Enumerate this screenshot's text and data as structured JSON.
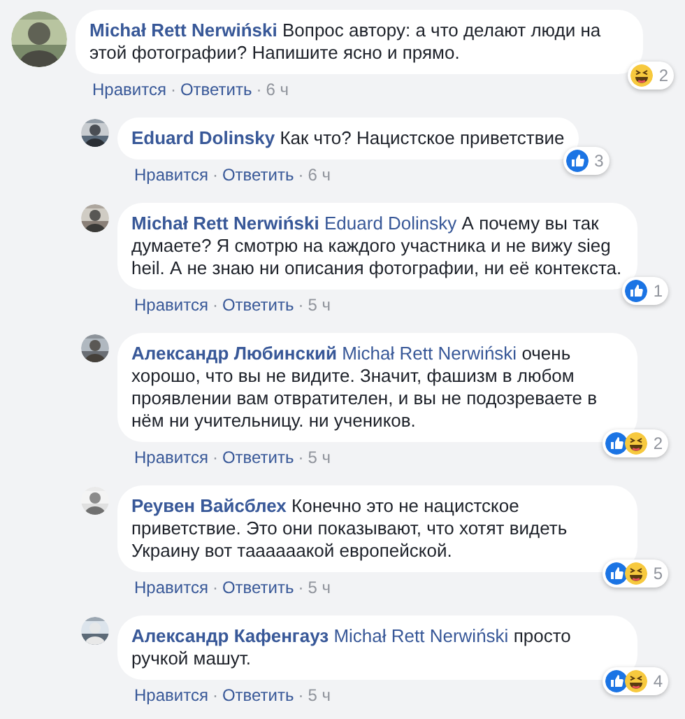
{
  "comments": [
    {
      "author": "Michał Rett Nerwiński",
      "text": "Вопрос автору: а что делают люди на этой фотографии? Напишите ясно и прямо.",
      "reply": false,
      "liked": false,
      "laughed": true,
      "count": "2",
      "actions": [
        "Нравится",
        "Ответить"
      ],
      "separator": "·",
      "time": "6 ч"
    },
    {
      "author": "Eduard Dolinsky",
      "text": "Как что? Нацистское приветствие",
      "reply": true,
      "liked": true,
      "laughed": false,
      "count": "3",
      "actions": [
        "Нравится",
        "Ответить"
      ],
      "separator": "·",
      "time": "6 ч"
    },
    {
      "author": "Michał Rett Nerwiński",
      "mention": "Eduard Dolinsky",
      "text": "А почему вы так думаете? Я смотрю на каждого участника и не вижу sieg heil. А не знаю ни описания фотографии, ни её контекста.",
      "reply": true,
      "liked": true,
      "laughed": false,
      "count": "1",
      "actions": [
        "Нравится",
        "Ответить"
      ],
      "separator": "·",
      "time": "5 ч"
    },
    {
      "author": "Александр Любинский",
      "mention": "Michał Rett Nerwiński",
      "text": "очень хорошо, что вы не видите. Значит, фашизм в любом проявлении вам отвратителен, и вы не подозреваете в нём ни учительницу. ни учеников.",
      "reply": true,
      "liked": true,
      "laughed": true,
      "count": "2",
      "actions": [
        "Нравится",
        "Ответить"
      ],
      "separator": "·",
      "time": "5 ч"
    },
    {
      "author": "Реувен Вайсблех",
      "text": "Конечно это не нацистское приветствие. Это они показывают, что хотят видеть Украину вот таааааакой европейской.",
      "reply": true,
      "liked": true,
      "laughed": true,
      "count": "5",
      "actions": [
        "Нравится",
        "Ответить"
      ],
      "separator": "·",
      "time": "5 ч"
    },
    {
      "author": "Александр Кафенгауз",
      "mention": "Michał Rett Nerwiński",
      "text": "просто ручкой машут.",
      "reply": true,
      "liked": true,
      "laughed": true,
      "count": "4",
      "actions": [
        "Нравится",
        "Ответить"
      ],
      "separator": "·",
      "time": "5 ч"
    }
  ]
}
